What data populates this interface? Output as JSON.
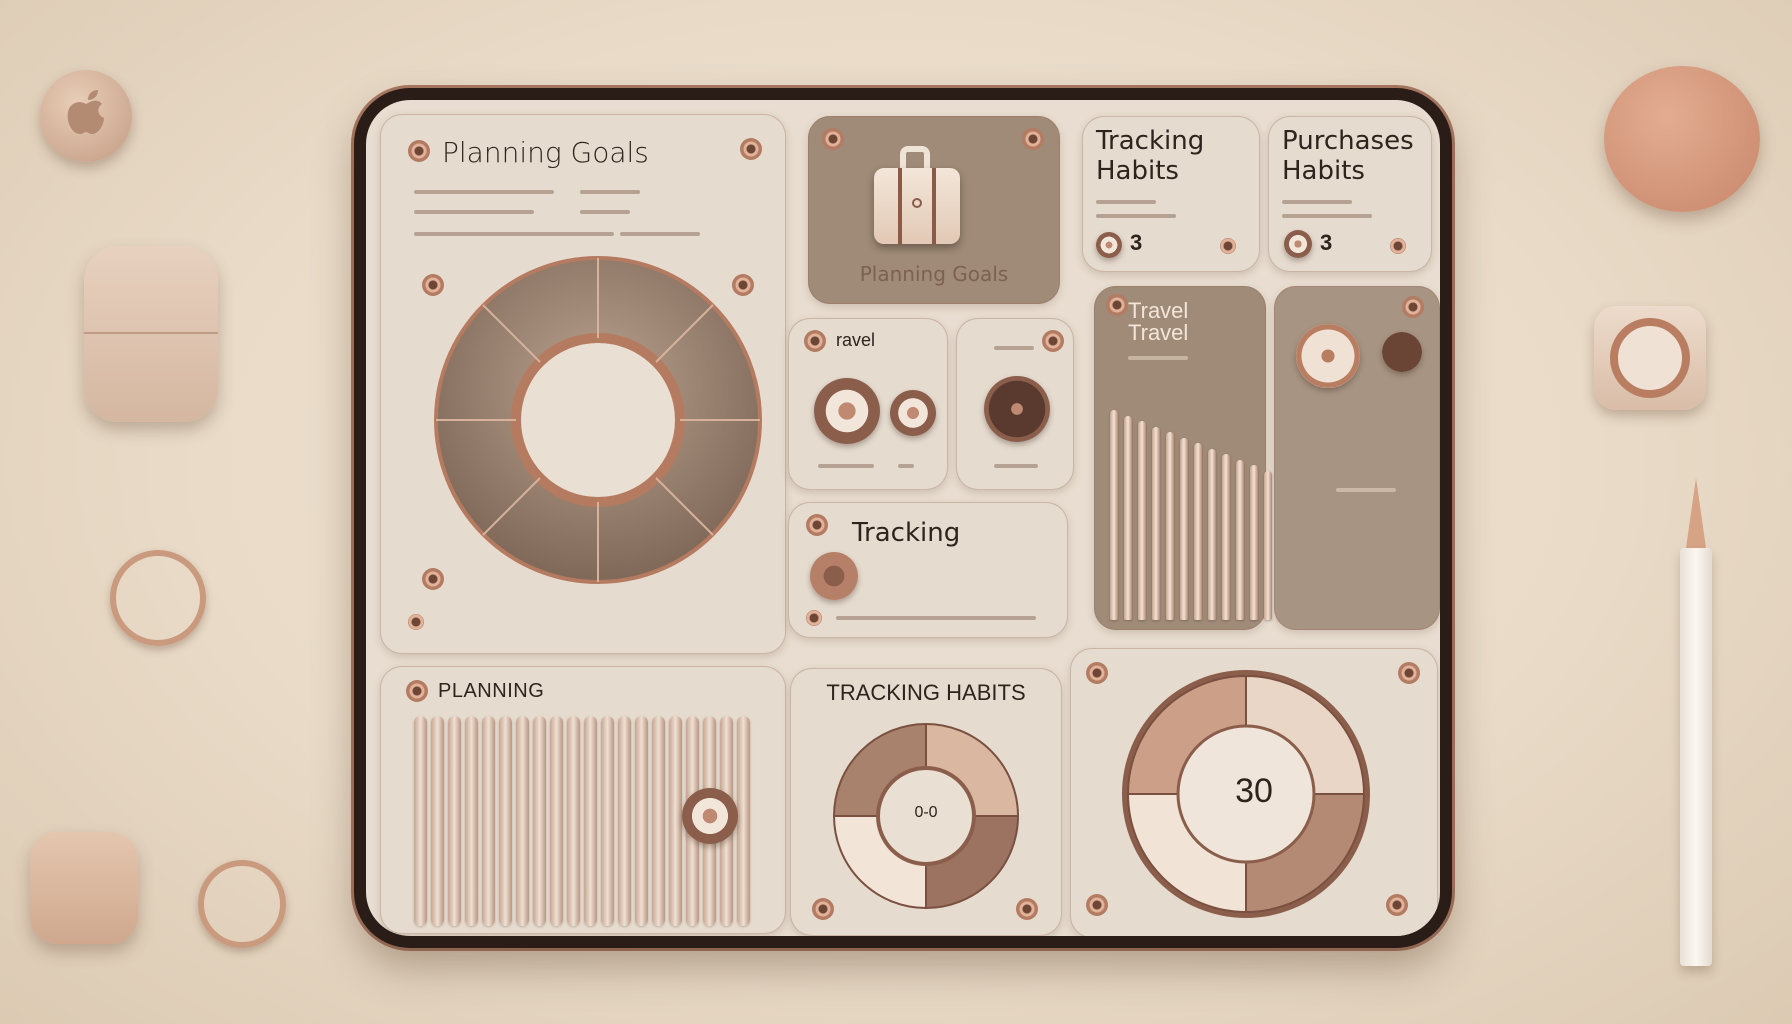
{
  "colors": {
    "accent": "#b27b62",
    "background": "#e9dbc8",
    "panel": "#e6dbcf",
    "ink": "#2e241e"
  },
  "decor": {
    "apple_logo": "apple-icon",
    "pencil": "pencil-icon"
  },
  "cards": {
    "planning_goals": {
      "title": "Planning Goals"
    },
    "luggage": {
      "title": "Planning Goals",
      "icon": "suitcase-icon"
    },
    "tracking_habits_top": {
      "title": "Tracking Habits",
      "count": "3"
    },
    "purchases_habits": {
      "title": "Purchases Habits",
      "count": "3"
    },
    "travel_small": {
      "title": "ravel"
    },
    "travel_chart": {
      "title": "Travel\nTravel"
    },
    "tracking": {
      "title": "Tracking"
    },
    "planning": {
      "title": "PLANNING"
    },
    "tracking_habits": {
      "title": "TRACKING HABITS",
      "donut_label": "0-0"
    },
    "gauge": {
      "value": "30"
    }
  }
}
